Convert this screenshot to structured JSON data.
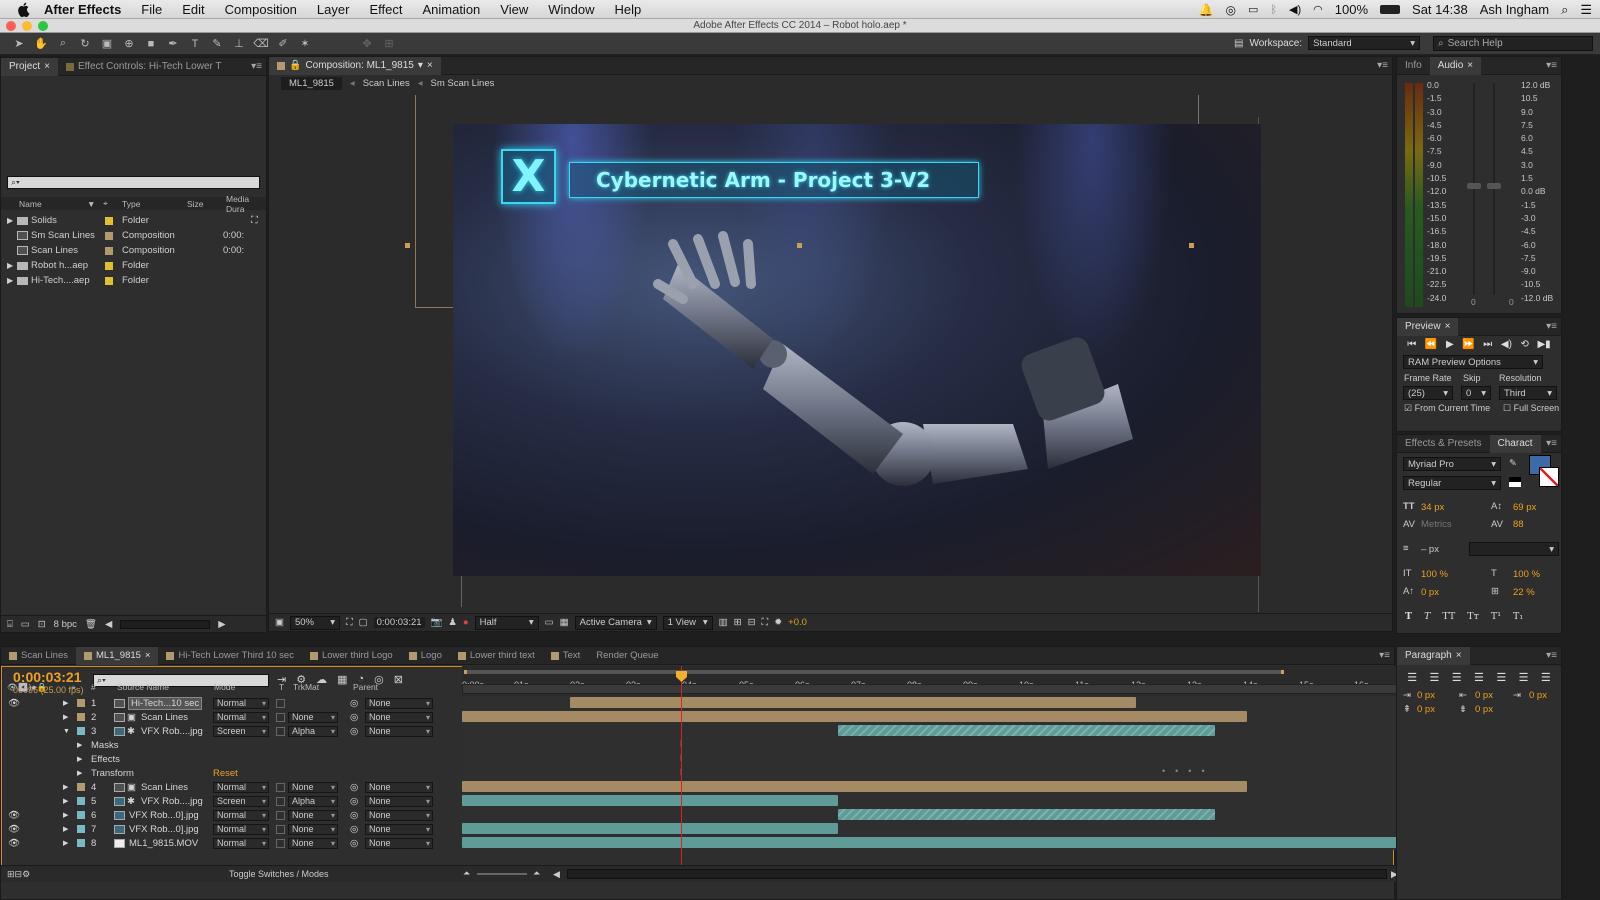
{
  "menubar": {
    "app": "After Effects",
    "items": [
      "File",
      "Edit",
      "Composition",
      "Layer",
      "Effect",
      "Animation",
      "View",
      "Window",
      "Help"
    ],
    "battery": "100%",
    "clock": "Sat 14:38",
    "user": "Ash Ingham"
  },
  "window_title": "Adobe After Effects CC 2014 – Robot holo.aep *",
  "toolbar": {
    "workspace_label": "Workspace:",
    "workspace_value": "Standard",
    "search_placeholder": "Search Help"
  },
  "project_panel": {
    "tab_project": "Project",
    "tab_effect": "Effect Controls: Hi-Tech Lower T",
    "columns": {
      "name": "Name",
      "type": "Type",
      "size": "Size",
      "media": "Media Dura"
    },
    "items": [
      {
        "name": "Solids",
        "type": "Folder",
        "dur": ""
      },
      {
        "name": "Sm Scan Lines",
        "type": "Composition",
        "dur": "0:00:"
      },
      {
        "name": "Scan Lines",
        "type": "Composition",
        "dur": "0:00:"
      },
      {
        "name": "Robot h...aep",
        "type": "Folder",
        "dur": ""
      },
      {
        "name": "Hi-Tech....aep",
        "type": "Folder",
        "dur": ""
      }
    ],
    "bpc": "8 bpc"
  },
  "viewer": {
    "tab": "Composition: ML1_9815",
    "breadcrumbs": [
      "ML1_9815",
      "Scan Lines",
      "Sm Scan Lines"
    ],
    "lower_third_text": "Cybernetic Arm - Project 3-V2",
    "badge": "X",
    "zoom": "50%",
    "timecode": "0:00:03:21",
    "resolution": "Half",
    "camera": "Active Camera",
    "views": "1 View",
    "exposure": "+0.0"
  },
  "info_panel": {
    "tab_info": "Info",
    "tab_audio": "Audio",
    "left_scale": [
      "0.0",
      "-1.5",
      "-3.0",
      "-4.5",
      "-6.0",
      "-7.5",
      "-9.0",
      "-10.5",
      "-12.0",
      "-13.5",
      "-15.0",
      "-16.5",
      "-18.0",
      "-19.5",
      "-21.0",
      "-22.5",
      "-24.0"
    ],
    "right_scale": [
      "12.0 dB",
      "10.5",
      "9.0",
      "7.5",
      "6.0",
      "4.5",
      "3.0",
      "1.5",
      "0.0 dB",
      "-1.5",
      "-3.0",
      "-4.5",
      "-6.0",
      "-7.5",
      "-9.0",
      "-10.5",
      "-12.0 dB"
    ],
    "zero_left": "0",
    "zero_right": "0"
  },
  "preview_panel": {
    "tab": "Preview",
    "options": "RAM Preview Options",
    "frame_rate_label": "Frame Rate",
    "skip_label": "Skip",
    "resolution_label": "Resolution",
    "frame_rate": "(25)",
    "skip": "0",
    "resolution": "Third",
    "from_current": "From Current Time",
    "full_screen": "Full Screen"
  },
  "character_panel": {
    "tab_effects": "Effects & Presets",
    "tab_character": "Charact",
    "font": "Myriad Pro",
    "style": "Regular",
    "size": "34 px",
    "leading": "69 px",
    "kerning": "Metrics",
    "tracking": "88",
    "stroke": "– px",
    "vscale": "100 %",
    "hscale": "100 %",
    "baseline": "0 px",
    "tsume": "22 %",
    "accent_color": "#3d6aa6"
  },
  "paragraph_panel": {
    "tab": "Paragraph",
    "indent_left": "0 px",
    "indent_right": "0 px",
    "indent_first": "0 px",
    "space_before": "0 px",
    "space_after": "0 px"
  },
  "timeline": {
    "tabs": [
      "Scan Lines",
      "ML1_9815",
      "Hi-Tech Lower Third 10 sec",
      "Lower third Logo",
      "Logo",
      "Lower third text",
      "Text",
      "Render Queue"
    ],
    "timecode": "0:00:03:21",
    "frames": "00096 (25.00 fps)",
    "columns": {
      "source": "Source Name",
      "mode": "Mode",
      "t": "T",
      "trkmat": "TrkMat",
      "parent": "Parent"
    },
    "ruler": [
      "0:00s",
      "01s",
      "02s",
      "03s",
      "04s",
      "05s",
      "06s",
      "07s",
      "08s",
      "09s",
      "10s",
      "11s",
      "12s",
      "13s",
      "14s",
      "15s",
      "16s"
    ],
    "layers": [
      {
        "num": "1",
        "name": "Hi-Tech...10 sec",
        "mode": "Normal",
        "trkmat": "",
        "parent": "None"
      },
      {
        "num": "2",
        "name": "Scan Lines",
        "mode": "Normal",
        "trkmat": "None",
        "parent": "None"
      },
      {
        "num": "3",
        "name": "VFX Rob....jpg",
        "mode": "Screen",
        "trkmat": "Alpha",
        "parent": "None"
      },
      {
        "num": "4",
        "name": "Scan Lines",
        "mode": "Normal",
        "trkmat": "None",
        "parent": "None"
      },
      {
        "num": "5",
        "name": "VFX Rob....jpg",
        "mode": "Screen",
        "trkmat": "Alpha",
        "parent": "None"
      },
      {
        "num": "6",
        "name": "VFX Rob...0].jpg",
        "mode": "Normal",
        "trkmat": "None",
        "parent": "None"
      },
      {
        "num": "7",
        "name": "VFX Rob...0].jpg",
        "mode": "Normal",
        "trkmat": "None",
        "parent": "None"
      },
      {
        "num": "8",
        "name": "ML1_9815.MOV",
        "mode": "Normal",
        "trkmat": "None",
        "parent": "None"
      }
    ],
    "sub": {
      "masks": "Masks",
      "effects": "Effects",
      "transform": "Transform",
      "reset": "Reset"
    },
    "toggle": "Toggle Switches / Modes"
  }
}
